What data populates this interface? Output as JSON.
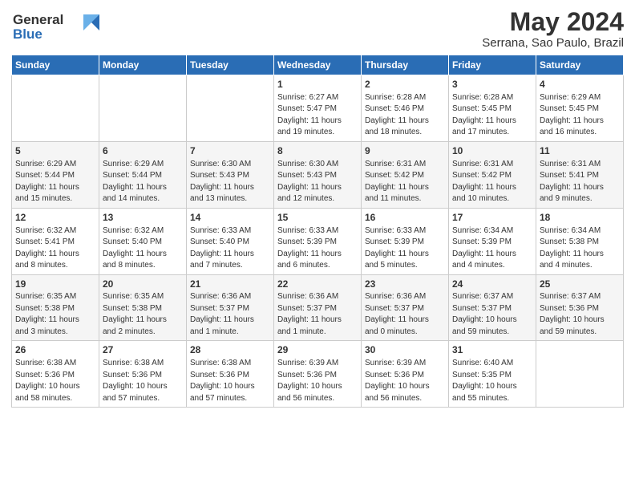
{
  "header": {
    "logo_line1": "General",
    "logo_line2": "Blue",
    "month_year": "May 2024",
    "location": "Serrana, Sao Paulo, Brazil"
  },
  "days_of_week": [
    "Sunday",
    "Monday",
    "Tuesday",
    "Wednesday",
    "Thursday",
    "Friday",
    "Saturday"
  ],
  "weeks": [
    [
      {
        "day": "",
        "info": ""
      },
      {
        "day": "",
        "info": ""
      },
      {
        "day": "",
        "info": ""
      },
      {
        "day": "1",
        "info": "Sunrise: 6:27 AM\nSunset: 5:47 PM\nDaylight: 11 hours\nand 19 minutes."
      },
      {
        "day": "2",
        "info": "Sunrise: 6:28 AM\nSunset: 5:46 PM\nDaylight: 11 hours\nand 18 minutes."
      },
      {
        "day": "3",
        "info": "Sunrise: 6:28 AM\nSunset: 5:45 PM\nDaylight: 11 hours\nand 17 minutes."
      },
      {
        "day": "4",
        "info": "Sunrise: 6:29 AM\nSunset: 5:45 PM\nDaylight: 11 hours\nand 16 minutes."
      }
    ],
    [
      {
        "day": "5",
        "info": "Sunrise: 6:29 AM\nSunset: 5:44 PM\nDaylight: 11 hours\nand 15 minutes."
      },
      {
        "day": "6",
        "info": "Sunrise: 6:29 AM\nSunset: 5:44 PM\nDaylight: 11 hours\nand 14 minutes."
      },
      {
        "day": "7",
        "info": "Sunrise: 6:30 AM\nSunset: 5:43 PM\nDaylight: 11 hours\nand 13 minutes."
      },
      {
        "day": "8",
        "info": "Sunrise: 6:30 AM\nSunset: 5:43 PM\nDaylight: 11 hours\nand 12 minutes."
      },
      {
        "day": "9",
        "info": "Sunrise: 6:31 AM\nSunset: 5:42 PM\nDaylight: 11 hours\nand 11 minutes."
      },
      {
        "day": "10",
        "info": "Sunrise: 6:31 AM\nSunset: 5:42 PM\nDaylight: 11 hours\nand 10 minutes."
      },
      {
        "day": "11",
        "info": "Sunrise: 6:31 AM\nSunset: 5:41 PM\nDaylight: 11 hours\nand 9 minutes."
      }
    ],
    [
      {
        "day": "12",
        "info": "Sunrise: 6:32 AM\nSunset: 5:41 PM\nDaylight: 11 hours\nand 8 minutes."
      },
      {
        "day": "13",
        "info": "Sunrise: 6:32 AM\nSunset: 5:40 PM\nDaylight: 11 hours\nand 8 minutes."
      },
      {
        "day": "14",
        "info": "Sunrise: 6:33 AM\nSunset: 5:40 PM\nDaylight: 11 hours\nand 7 minutes."
      },
      {
        "day": "15",
        "info": "Sunrise: 6:33 AM\nSunset: 5:39 PM\nDaylight: 11 hours\nand 6 minutes."
      },
      {
        "day": "16",
        "info": "Sunrise: 6:33 AM\nSunset: 5:39 PM\nDaylight: 11 hours\nand 5 minutes."
      },
      {
        "day": "17",
        "info": "Sunrise: 6:34 AM\nSunset: 5:39 PM\nDaylight: 11 hours\nand 4 minutes."
      },
      {
        "day": "18",
        "info": "Sunrise: 6:34 AM\nSunset: 5:38 PM\nDaylight: 11 hours\nand 4 minutes."
      }
    ],
    [
      {
        "day": "19",
        "info": "Sunrise: 6:35 AM\nSunset: 5:38 PM\nDaylight: 11 hours\nand 3 minutes."
      },
      {
        "day": "20",
        "info": "Sunrise: 6:35 AM\nSunset: 5:38 PM\nDaylight: 11 hours\nand 2 minutes."
      },
      {
        "day": "21",
        "info": "Sunrise: 6:36 AM\nSunset: 5:37 PM\nDaylight: 11 hours\nand 1 minute."
      },
      {
        "day": "22",
        "info": "Sunrise: 6:36 AM\nSunset: 5:37 PM\nDaylight: 11 hours\nand 1 minute."
      },
      {
        "day": "23",
        "info": "Sunrise: 6:36 AM\nSunset: 5:37 PM\nDaylight: 11 hours\nand 0 minutes."
      },
      {
        "day": "24",
        "info": "Sunrise: 6:37 AM\nSunset: 5:37 PM\nDaylight: 10 hours\nand 59 minutes."
      },
      {
        "day": "25",
        "info": "Sunrise: 6:37 AM\nSunset: 5:36 PM\nDaylight: 10 hours\nand 59 minutes."
      }
    ],
    [
      {
        "day": "26",
        "info": "Sunrise: 6:38 AM\nSunset: 5:36 PM\nDaylight: 10 hours\nand 58 minutes."
      },
      {
        "day": "27",
        "info": "Sunrise: 6:38 AM\nSunset: 5:36 PM\nDaylight: 10 hours\nand 57 minutes."
      },
      {
        "day": "28",
        "info": "Sunrise: 6:38 AM\nSunset: 5:36 PM\nDaylight: 10 hours\nand 57 minutes."
      },
      {
        "day": "29",
        "info": "Sunrise: 6:39 AM\nSunset: 5:36 PM\nDaylight: 10 hours\nand 56 minutes."
      },
      {
        "day": "30",
        "info": "Sunrise: 6:39 AM\nSunset: 5:36 PM\nDaylight: 10 hours\nand 56 minutes."
      },
      {
        "day": "31",
        "info": "Sunrise: 6:40 AM\nSunset: 5:35 PM\nDaylight: 10 hours\nand 55 minutes."
      },
      {
        "day": "",
        "info": ""
      }
    ]
  ]
}
